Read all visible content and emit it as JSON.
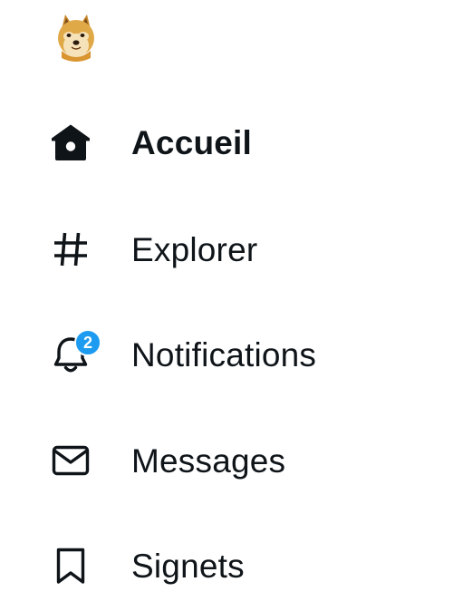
{
  "logo": {
    "icon": "doge-avatar-icon"
  },
  "nav": {
    "items": [
      {
        "label": "Accueil",
        "icon": "home-icon",
        "active": true
      },
      {
        "label": "Explorer",
        "icon": "hashtag-icon",
        "active": false
      },
      {
        "label": "Notifications",
        "icon": "bell-icon",
        "active": false,
        "badge": "2"
      },
      {
        "label": "Messages",
        "icon": "envelope-icon",
        "active": false
      },
      {
        "label": "Signets",
        "icon": "bookmark-icon",
        "active": false
      }
    ]
  },
  "colors": {
    "text": "#0f1419",
    "badge_bg": "#1d9bf0",
    "badge_text": "#ffffff"
  }
}
